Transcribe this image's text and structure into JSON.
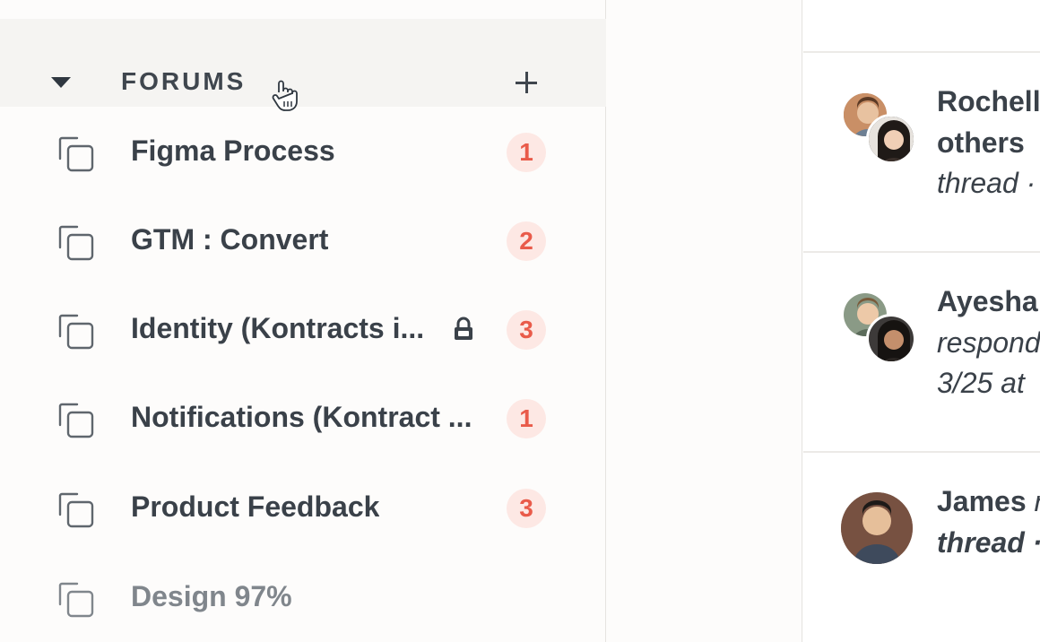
{
  "sidebar": {
    "section_title": "FORUMS",
    "forums": [
      {
        "name": "Figma Process",
        "badge": "1",
        "locked": false
      },
      {
        "name": "GTM : Convert",
        "badge": "2",
        "locked": false
      },
      {
        "name": "Identity (Kontracts i...",
        "badge": "3",
        "locked": true
      },
      {
        "name": "Notifications (Kontract ...",
        "badge": "1",
        "locked": false
      },
      {
        "name": "Product Feedback",
        "badge": "3",
        "locked": false
      },
      {
        "name": "Design 97%",
        "badge": "",
        "locked": false
      }
    ]
  },
  "feed": {
    "items": [
      {
        "line1": "Rochell",
        "line2": "others",
        "line3": "thread ·"
      },
      {
        "line1": "Ayesha",
        "line2": "respond",
        "line3": "3/25 at"
      },
      {
        "line1": "James",
        "line1_suffix": "r",
        "line2": "thread ·",
        "line3": ""
      }
    ]
  },
  "colors": {
    "badge_bg": "#fde8e4",
    "badge_text": "#e95b4a",
    "header_bg": "#f5f4f2"
  }
}
